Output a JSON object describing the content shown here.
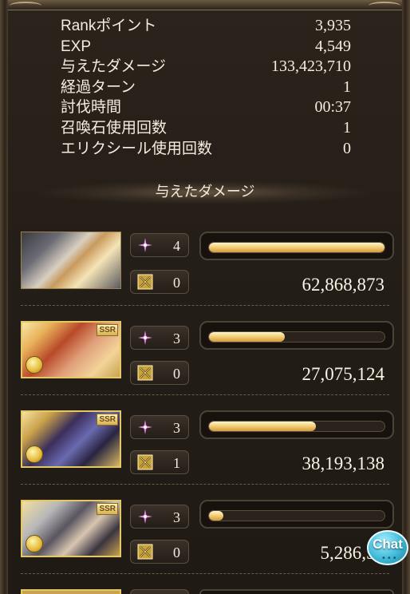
{
  "stats": [
    {
      "label": "Rankポイント",
      "value": "3,935"
    },
    {
      "label": "EXP",
      "value": "4,549"
    },
    {
      "label": "与えたダメージ",
      "value": "133,423,710"
    },
    {
      "label": "経過ターン",
      "value": "1"
    },
    {
      "label": "討伐時間",
      "value": "00:37"
    },
    {
      "label": "召喚石使用回数",
      "value": "1"
    },
    {
      "label": "エリクシール使用回数",
      "value": "0"
    }
  ],
  "section_title": "与えたダメージ",
  "characters": [
    {
      "rarity_badge": "",
      "ougi_count": "4",
      "skill_count": "0",
      "damage": "62,868,873",
      "damage_share": 1.0
    },
    {
      "rarity_badge": "SSR",
      "ougi_count": "3",
      "skill_count": "0",
      "damage": "27,075,124",
      "damage_share": 0.43
    },
    {
      "rarity_badge": "SSR",
      "ougi_count": "3",
      "skill_count": "1",
      "damage": "38,193,138",
      "damage_share": 0.61
    },
    {
      "rarity_badge": "SSR",
      "ougi_count": "3",
      "skill_count": "0",
      "damage": "5,286,57",
      "damage_share": 0.08
    }
  ],
  "chat": {
    "label": "Chat",
    "dots": "•••"
  },
  "colors": {
    "bar_fill": "#f3d07c",
    "ougi_icon": "#e06fe3",
    "frame": "#2b241c"
  }
}
